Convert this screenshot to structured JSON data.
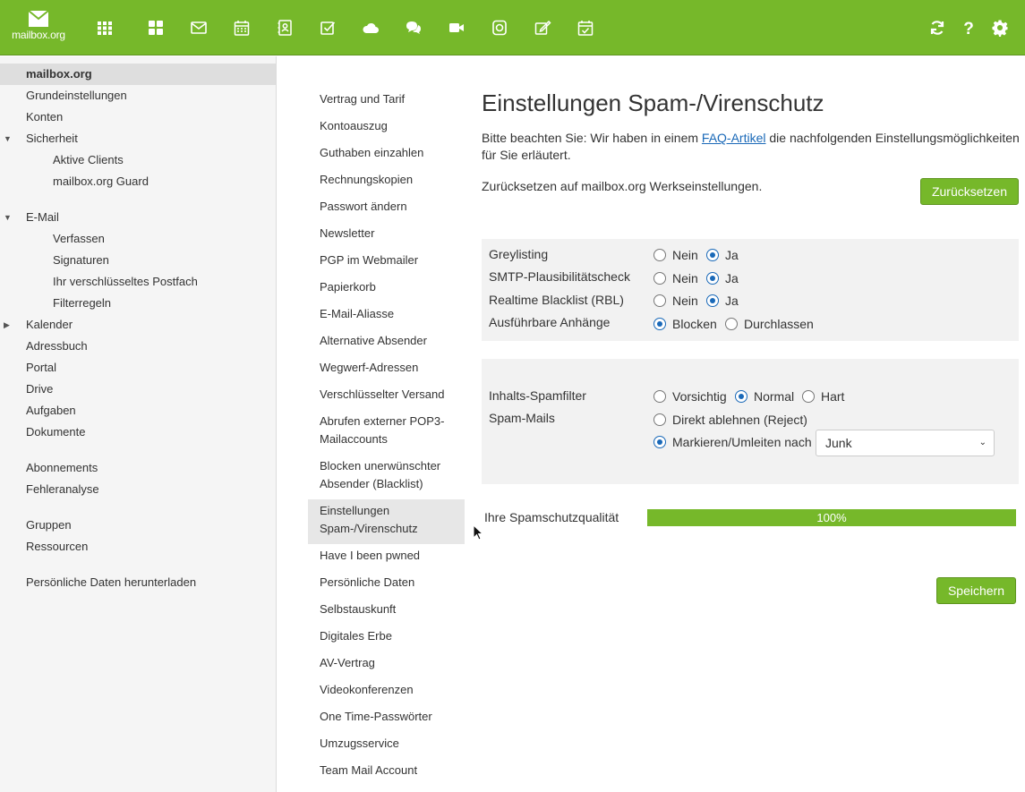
{
  "topbar": {
    "logo_text": "mailbox.org",
    "apps": [
      {
        "icon": "grid-icon"
      },
      {
        "icon": "dashboard-icon"
      },
      {
        "icon": "mail-icon"
      },
      {
        "icon": "calendar-icon"
      },
      {
        "icon": "contacts-icon"
      },
      {
        "icon": "tasks-icon"
      },
      {
        "icon": "cloud-icon"
      },
      {
        "icon": "chat-icon"
      },
      {
        "icon": "video-icon"
      },
      {
        "icon": "office-icon"
      },
      {
        "icon": "edit-icon"
      },
      {
        "icon": "calendar-check-icon"
      }
    ],
    "right_icons": [
      "refresh-icon",
      "help-icon",
      "settings-icon"
    ],
    "accent": "#76b82a"
  },
  "sidebar": {
    "items": [
      {
        "label": "mailbox.org",
        "active": true
      },
      {
        "label": "Grundeinstellungen"
      },
      {
        "label": "Konten"
      },
      {
        "label": "Sicherheit",
        "caret": "down"
      },
      {
        "label": "Aktive Clients",
        "indent": true
      },
      {
        "label": "mailbox.org Guard",
        "indent": true
      },
      {
        "label": "E-Mail",
        "caret": "down"
      },
      {
        "label": "Verfassen",
        "indent": true
      },
      {
        "label": "Signaturen",
        "indent": true
      },
      {
        "label": "Ihr verschlüsseltes Postfach",
        "indent": true
      },
      {
        "label": "Filterregeln",
        "indent": true
      },
      {
        "label": "Kalender",
        "caret": "right"
      },
      {
        "label": "Adressbuch"
      },
      {
        "label": "Portal"
      },
      {
        "label": "Drive"
      },
      {
        "label": "Aufgaben"
      },
      {
        "label": "Dokumente"
      },
      {
        "label": "Abonnements"
      },
      {
        "label": "Fehleranalyse"
      },
      {
        "label": "Gruppen"
      },
      {
        "label": "Ressourcen"
      },
      {
        "label": "Persönliche Daten herunterladen"
      }
    ]
  },
  "subnav": {
    "items": [
      {
        "label": "Vertrag und Tarif"
      },
      {
        "label": "Kontoauszug"
      },
      {
        "label": "Guthaben einzahlen"
      },
      {
        "label": "Rechnungskopien"
      },
      {
        "label": "Passwort ändern"
      },
      {
        "label": "Newsletter"
      },
      {
        "label": "PGP im Webmailer"
      },
      {
        "label": "Papierkorb"
      },
      {
        "label": "E-Mail-Aliasse"
      },
      {
        "label": "Alternative Absender"
      },
      {
        "label": "Wegwerf-Adressen"
      },
      {
        "label": "Verschlüsselter Versand"
      },
      {
        "label": "Abrufen externer POP3-Mailaccounts"
      },
      {
        "label": "Blocken unerwünschter Absender (Blacklist)"
      },
      {
        "label": "Einstellungen Spam-/Virenschutz",
        "active": true
      },
      {
        "label": "Have I been pwned"
      },
      {
        "label": "Persönliche Daten"
      },
      {
        "label": "Selbstauskunft"
      },
      {
        "label": "Digitales Erbe"
      },
      {
        "label": "AV-Vertrag"
      },
      {
        "label": "Videokonferenzen"
      },
      {
        "label": "One Time-Passwörter"
      },
      {
        "label": "Umzugsservice"
      },
      {
        "label": "Team Mail Account"
      }
    ]
  },
  "main": {
    "title": "Einstellungen Spam-/Virenschutz",
    "intro_before": "Bitte beachten Sie: Wir haben in einem ",
    "intro_link": "FAQ-Artikel",
    "intro_after": " die nachfolgenden Einstellungsmöglichkeiten für Sie erläutert.",
    "reset_text": "Zurücksetzen auf mailbox.org Werkseinstellungen.",
    "reset_button": "Zurücksetzen",
    "settings1": [
      {
        "label": "Greylisting",
        "options": [
          "Nein",
          "Ja"
        ],
        "selected": 1
      },
      {
        "label": "SMTP-Plausibilitätscheck",
        "options": [
          "Nein",
          "Ja"
        ],
        "selected": 1
      },
      {
        "label": "Realtime Blacklist (RBL)",
        "options": [
          "Nein",
          "Ja"
        ],
        "selected": 1
      },
      {
        "label": "Ausführbare Anhänge",
        "options": [
          "Blocken",
          "Durchlassen"
        ],
        "selected": 0
      }
    ],
    "content_filter": {
      "label": "Inhalts-Spamfilter",
      "options": [
        "Vorsichtig",
        "Normal",
        "Hart"
      ],
      "selected": 1
    },
    "spam_mails": {
      "label": "Spam-Mails",
      "options": [
        "Direkt ablehnen (Reject)",
        "Markieren/Umleiten nach"
      ],
      "selected": 1
    },
    "folder_select": "Junk",
    "quality_label": "Ihre Spamschutzqualität",
    "quality_value": 1.0,
    "quality_text": "100%",
    "save_button": "Speichern"
  }
}
